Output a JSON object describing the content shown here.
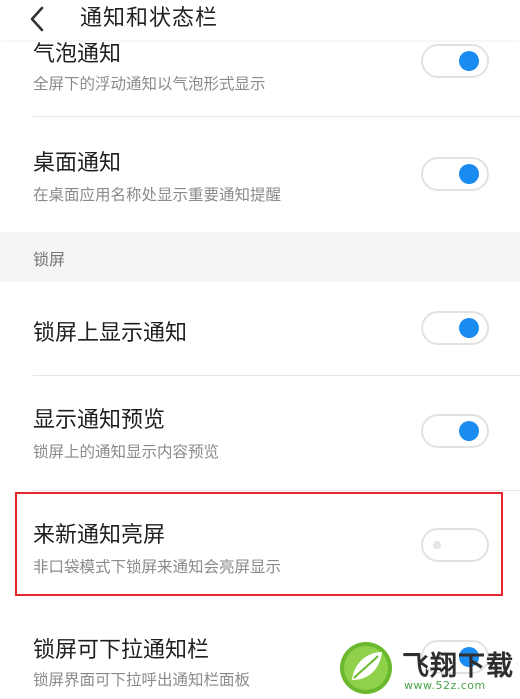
{
  "header": {
    "title": "通知和状态栏",
    "back_icon": "chevron-left-icon"
  },
  "rows": [
    {
      "id": "bubble",
      "title": "气泡通知",
      "desc": "全屏下的浮动通知以气泡形式显示",
      "enabled": true
    },
    {
      "id": "desktop",
      "title": "桌面通知",
      "desc": "在桌面应用名称处显示重要通知提醒",
      "enabled": true
    },
    {
      "id": "lockscreen-show",
      "title": "锁屏上显示通知",
      "desc": "",
      "enabled": true
    },
    {
      "id": "preview",
      "title": "显示通知预览",
      "desc": "锁屏上的通知显示内容预览",
      "enabled": true
    },
    {
      "id": "wake-screen",
      "title": "来新通知亮屏",
      "desc": "非口袋模式下锁屏来通知会亮屏显示",
      "enabled": false
    },
    {
      "id": "pulldown",
      "title": "锁屏可下拉通知栏",
      "desc": "锁屏界面可下拉呼出通知栏面板",
      "enabled": true
    }
  ],
  "sections": {
    "lockscreen": "锁屏"
  },
  "watermark": {
    "brand": "飞翔下载",
    "url": "www.52z.com"
  },
  "colors": {
    "accent": "#1a8cf0",
    "highlight": "#e8262b",
    "section_bg": "#f5f5f5"
  }
}
